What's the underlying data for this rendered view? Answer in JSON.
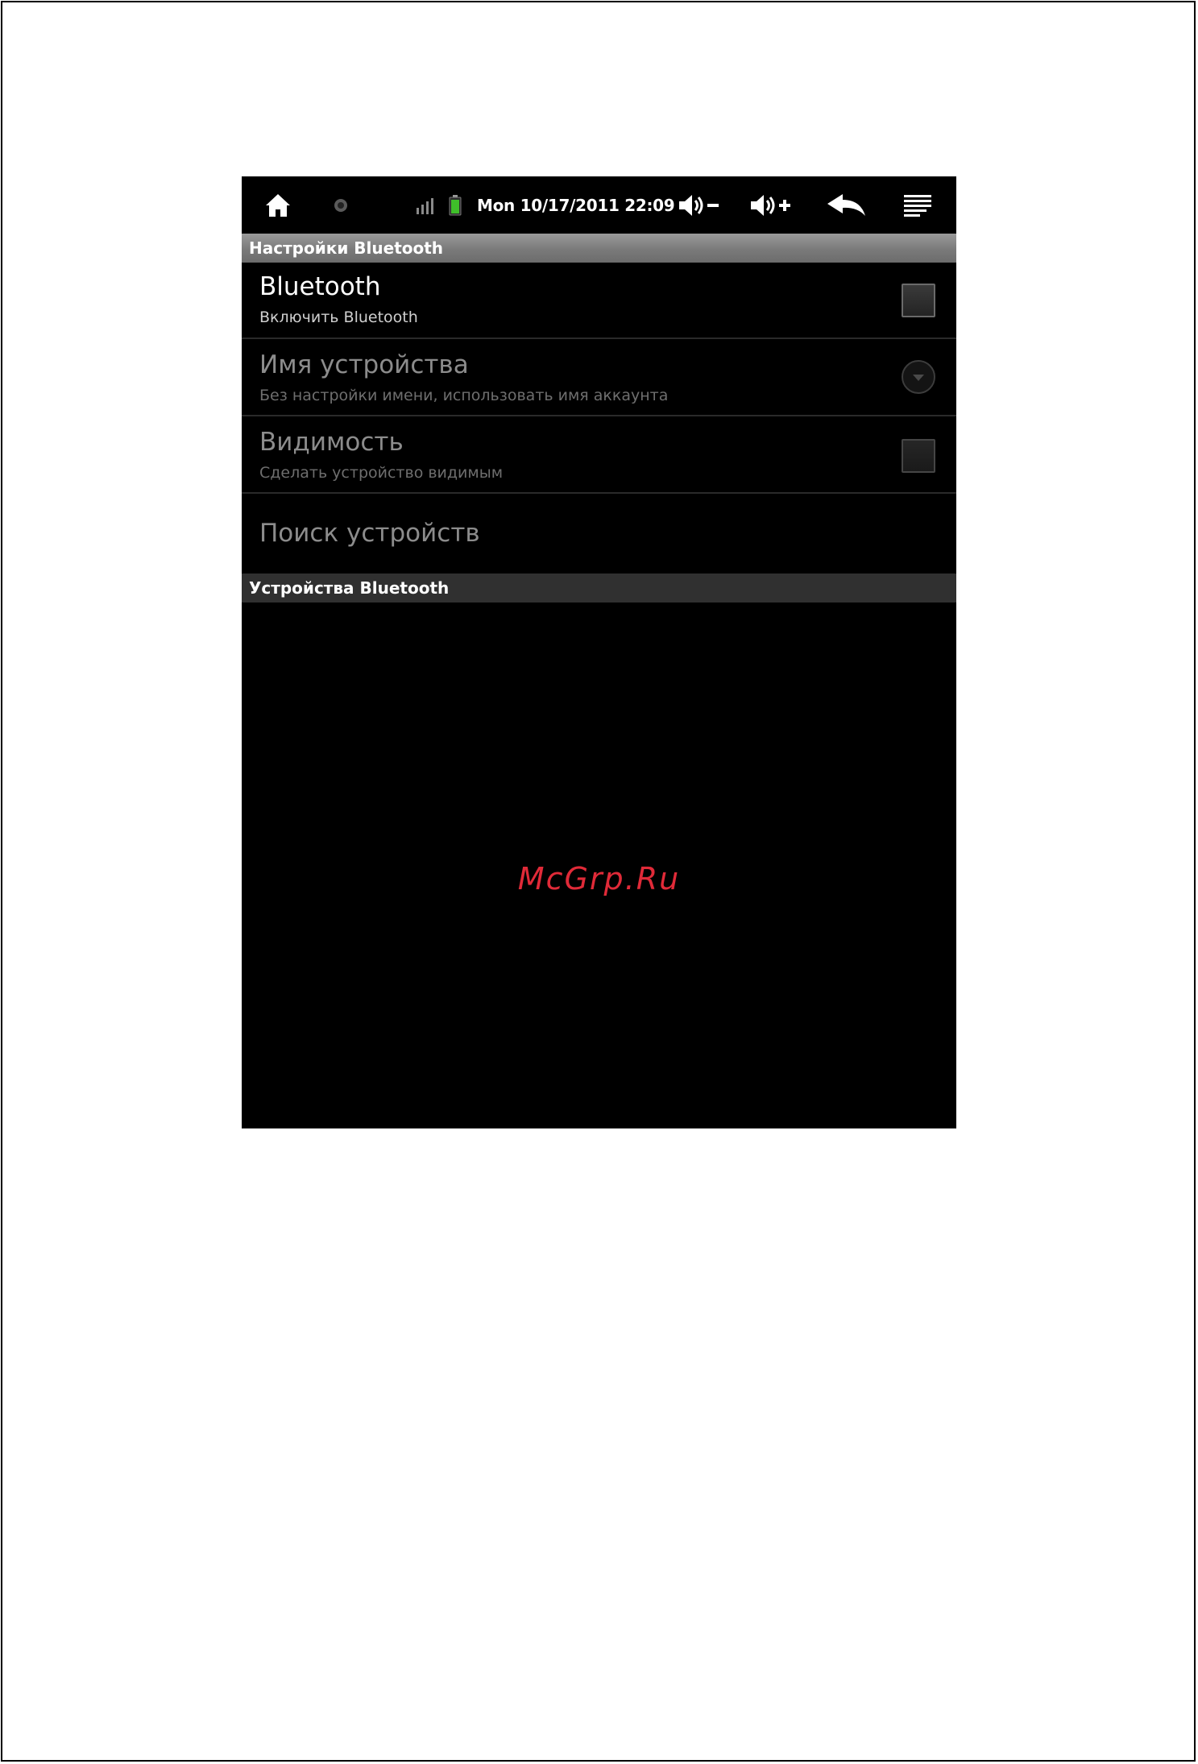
{
  "status_bar": {
    "datetime": "Mon 10/17/2011 22:09",
    "icons": [
      "home-icon",
      "record-dot-icon",
      "signal-icon",
      "battery-icon",
      "volume-down-icon",
      "volume-up-icon",
      "back-icon",
      "menu-icon"
    ],
    "battery_color": "#3fbf2a"
  },
  "settings_header": "Настройки Bluetooth",
  "preferences": [
    {
      "title": "Bluetooth",
      "summary": "Включить Bluetooth",
      "widget": "checkbox",
      "checked": false,
      "enabled": true
    },
    {
      "title": "Имя устройства",
      "summary": "Без настройки имени, использовать имя аккаунта",
      "widget": "dropdown",
      "enabled": false
    },
    {
      "title": "Видимость",
      "summary": "Сделать устройство видимым",
      "widget": "checkbox",
      "checked": false,
      "enabled": false
    },
    {
      "title": "Поиск устройств",
      "enabled": false
    }
  ],
  "devices_header": "Устройства Bluetooth",
  "watermark": "McGrp.Ru",
  "colors": {
    "screen_background": "#000000",
    "header_background": "#8a8a8a",
    "watermark": "#e02a38"
  }
}
